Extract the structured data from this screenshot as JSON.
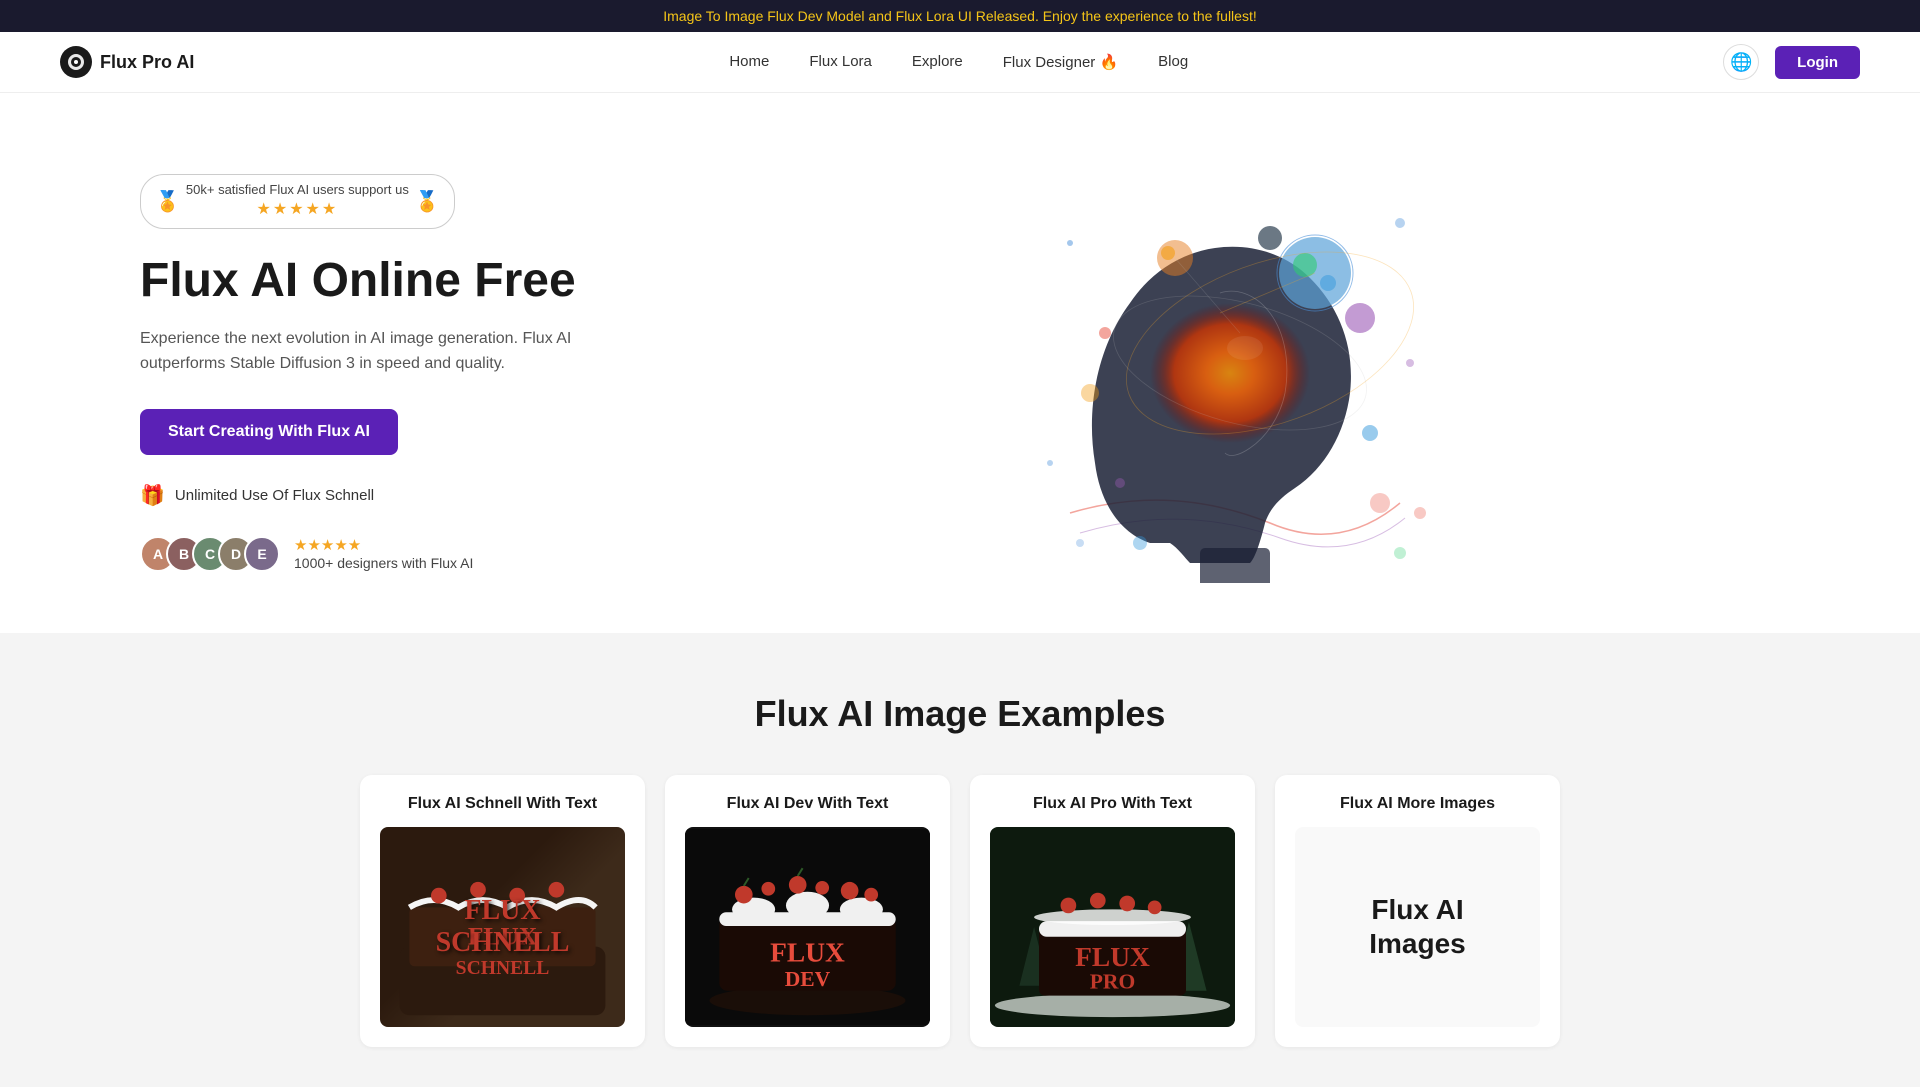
{
  "banner": {
    "text": "Image To Image Flux Dev Model and Flux Lora UI Released. Enjoy the experience to the fullest!"
  },
  "nav": {
    "logo_text": "Flux Pro AI",
    "links": [
      {
        "label": "Home",
        "id": "home"
      },
      {
        "label": "Flux Lora",
        "id": "flux-lora"
      },
      {
        "label": "Explore",
        "id": "explore"
      },
      {
        "label": "Flux Designer 🔥",
        "id": "flux-designer"
      },
      {
        "label": "Blog",
        "id": "blog"
      }
    ],
    "login_label": "Login"
  },
  "hero": {
    "badge_text": "50k+ satisfied Flux AI users support us",
    "stars": "★★★★★",
    "title": "Flux AI Online Free",
    "description": "Experience the next evolution in AI image generation. Flux AI outperforms Stable Diffusion 3 in speed and quality.",
    "cta_label": "Start Creating With Flux AI",
    "unlimited_label": "Unlimited Use Of Flux Schnell",
    "social_stars": "★★★★★",
    "social_text": "1000+ designers with Flux AI"
  },
  "examples": {
    "section_title": "Flux AI Image Examples",
    "cards": [
      {
        "title": "Flux AI Schnell With Text",
        "type": "schnell"
      },
      {
        "title": "Flux AI Dev With Text",
        "type": "dev"
      },
      {
        "title": "Flux AI Pro With Text",
        "type": "pro"
      },
      {
        "title": "Flux AI More Images",
        "type": "more"
      }
    ]
  }
}
